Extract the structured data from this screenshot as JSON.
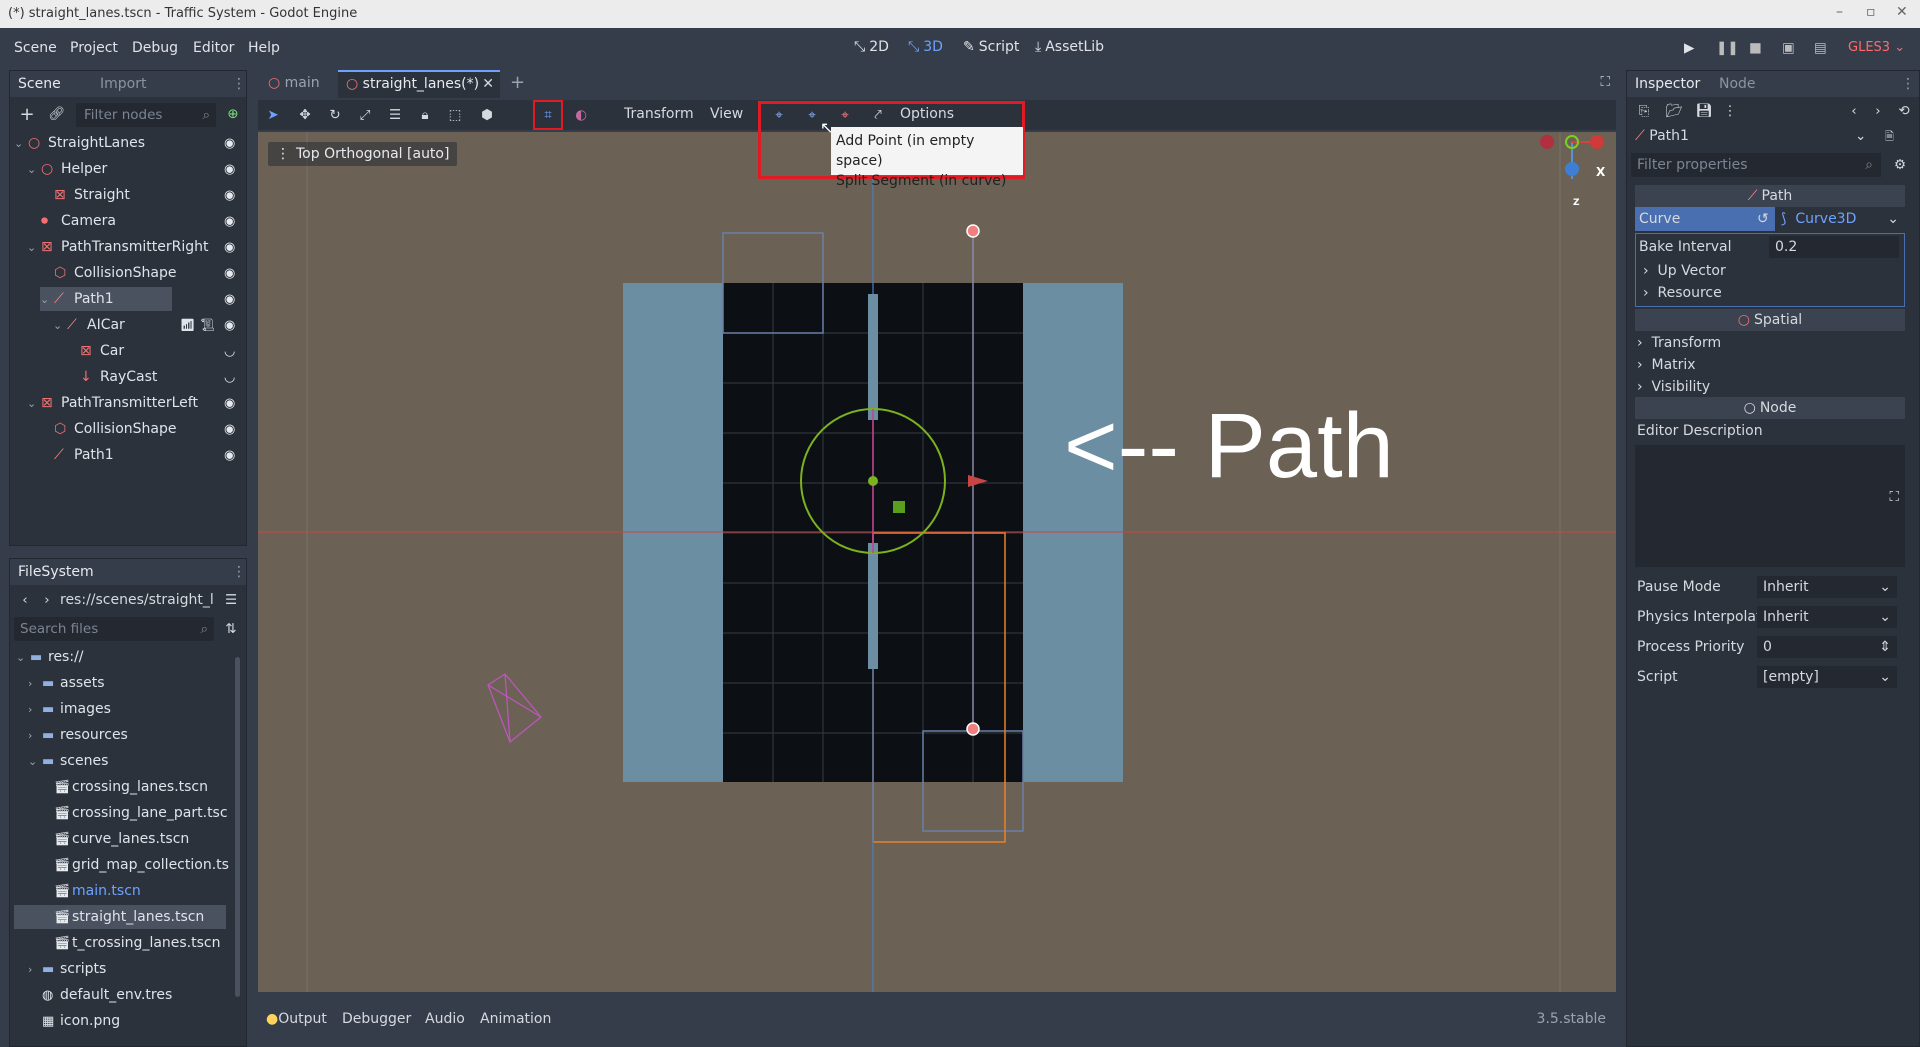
{
  "window": {
    "title": "(*) straight_lanes.tscn - Traffic System - Godot Engine"
  },
  "menu": {
    "items": [
      "Scene",
      "Project",
      "Debug",
      "Editor",
      "Help"
    ]
  },
  "modes": {
    "m2d": "2D",
    "m3d": "3D",
    "script": "Script",
    "assetlib": "AssetLib"
  },
  "renderer": "GLES3",
  "scene_dock": {
    "tabs": [
      "Scene",
      "Import"
    ],
    "filter_placeholder": "Filter nodes",
    "nodes": [
      "StraightLanes",
      "Helper",
      "Straight",
      "Camera",
      "PathTransmitterRight",
      "CollisionShape",
      "Path1",
      "AICar",
      "Car",
      "RayCast",
      "PathTransmitterLeft",
      "CollisionShape",
      "Path1"
    ]
  },
  "filesystem": {
    "title": "FileSystem",
    "path": "res://scenes/straight_l",
    "search_placeholder": "Search files",
    "items": [
      "res://",
      "assets",
      "images",
      "resources",
      "scenes",
      "crossing_lanes.tscn",
      "crossing_lane_part.tsc",
      "curve_lanes.tscn",
      "grid_map_collection.ts",
      "main.tscn",
      "straight_lanes.tscn",
      "t_crossing_lanes.tscn",
      "scripts",
      "default_env.tres",
      "icon.png"
    ]
  },
  "editor_tabs": {
    "main": "main",
    "current": "straight_lanes(*)"
  },
  "viewport_toolbar": {
    "transform": "Transform",
    "view": "View",
    "options": "Options"
  },
  "viewport": {
    "label": "Top Orthogonal [auto]",
    "annotation": "<-- Path",
    "gizmo_x": "X",
    "gizmo_z": "Z"
  },
  "tooltip": {
    "line1": "Add Point (in empty space)",
    "line2": "Split Segment (in curve)"
  },
  "bottom_tabs": {
    "output": "Output",
    "debugger": "Debugger",
    "audio": "Audio",
    "animation": "Animation",
    "version": "3.5.stable"
  },
  "inspector": {
    "tabs": [
      "Inspector",
      "Node"
    ],
    "node": "Path1",
    "filter_placeholder": "Filter properties",
    "sections": {
      "path": "Path",
      "spatial": "Spatial",
      "node": "Node"
    },
    "curve": {
      "label": "Curve",
      "value": "Curve3D"
    },
    "bake_interval": {
      "label": "Bake Interval",
      "value": "0.2"
    },
    "sub": [
      "Up Vector",
      "Resource"
    ],
    "spatial_items": [
      "Transform",
      "Matrix",
      "Visibility"
    ],
    "editor_description": "Editor Description",
    "props": [
      {
        "k": "Pause Mode",
        "v": "Inherit"
      },
      {
        "k": "Physics Interpolati",
        "v": "Inherit"
      },
      {
        "k": "Process Priority",
        "v": "0"
      },
      {
        "k": "Script",
        "v": "[empty]"
      }
    ]
  },
  "colors": {
    "accent": "#6ea2ff",
    "selection_red": "#e01b24",
    "viewport_bg": "#6b6255"
  }
}
